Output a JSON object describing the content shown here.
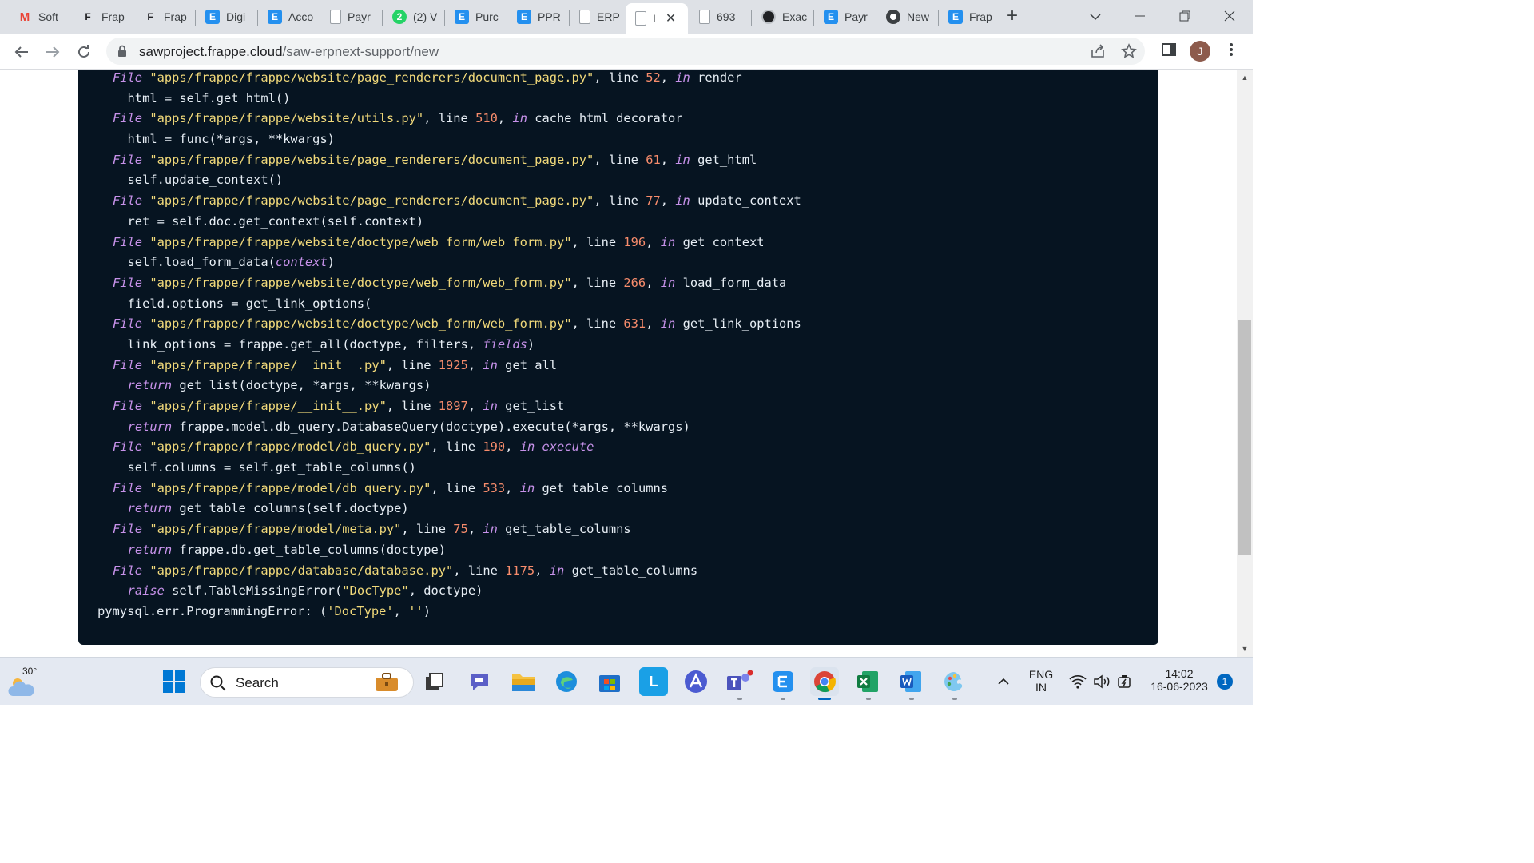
{
  "browser": {
    "tabs": [
      {
        "title": "Soft",
        "favicon": "gmail-icon",
        "color": "#ffffff"
      },
      {
        "title": "Frap",
        "favicon": "frappe-icon",
        "color": "#ffffff"
      },
      {
        "title": "Frap",
        "favicon": "frappe-icon",
        "color": "#ffffff"
      },
      {
        "title": "Digi",
        "favicon": "erpnext-icon",
        "color": "#2490ef"
      },
      {
        "title": "Acco",
        "favicon": "erpnext-icon",
        "color": "#2490ef"
      },
      {
        "title": "Payr",
        "favicon": "page-icon",
        "color": "#ffffff"
      },
      {
        "title": "(2) V",
        "favicon": "whatsapp-icon",
        "color": "#25d366"
      },
      {
        "title": "Purc",
        "favicon": "erpnext-icon",
        "color": "#2490ef"
      },
      {
        "title": "PPR",
        "favicon": "erpnext-icon",
        "color": "#2490ef"
      },
      {
        "title": "ERP",
        "favicon": "page-icon",
        "color": "#ffffff"
      },
      {
        "title": "I",
        "favicon": "page-icon",
        "color": "#ffffff"
      },
      {
        "title": "693",
        "favicon": "page-icon",
        "color": "#ffffff"
      },
      {
        "title": "Exac",
        "favicon": "chatgpt-icon",
        "color": "#10a37f"
      },
      {
        "title": "Payr",
        "favicon": "erpnext-icon",
        "color": "#2490ef"
      },
      {
        "title": "New",
        "favicon": "chrome-icon",
        "color": "#5f6368"
      },
      {
        "title": "Frap",
        "favicon": "erpnext-icon",
        "color": "#2490ef"
      }
    ],
    "address": {
      "domain": "sawproject.frappe.cloud",
      "path": "/saw-erpnext-support/new"
    },
    "avatar_letter": "J"
  },
  "traceback": [
    [
      [
        "f",
        "File "
      ],
      [
        "s",
        "\"apps/frappe/frappe/website/page_renderers/document_page.py\""
      ],
      [
        "p",
        ", line "
      ],
      [
        "n",
        "52"
      ],
      [
        "p",
        ", "
      ],
      [
        "i",
        "in"
      ],
      [
        "p",
        " render"
      ]
    ],
    [
      [
        "p",
        "  html = self.get_html()"
      ]
    ],
    [
      [
        "f",
        "File "
      ],
      [
        "s",
        "\"apps/frappe/frappe/website/utils.py\""
      ],
      [
        "p",
        ", line "
      ],
      [
        "n",
        "510"
      ],
      [
        "p",
        ", "
      ],
      [
        "i",
        "in"
      ],
      [
        "p",
        " cache_html_decorator"
      ]
    ],
    [
      [
        "p",
        "  html = func(*args, **kwargs)"
      ]
    ],
    [
      [
        "f",
        "File "
      ],
      [
        "s",
        "\"apps/frappe/frappe/website/page_renderers/document_page.py\""
      ],
      [
        "p",
        ", line "
      ],
      [
        "n",
        "61"
      ],
      [
        "p",
        ", "
      ],
      [
        "i",
        "in"
      ],
      [
        "p",
        " get_html"
      ]
    ],
    [
      [
        "p",
        "  self.update_context()"
      ]
    ],
    [
      [
        "f",
        "File "
      ],
      [
        "s",
        "\"apps/frappe/frappe/website/page_renderers/document_page.py\""
      ],
      [
        "p",
        ", line "
      ],
      [
        "n",
        "77"
      ],
      [
        "p",
        ", "
      ],
      [
        "i",
        "in"
      ],
      [
        "p",
        " update_context"
      ]
    ],
    [
      [
        "p",
        "  ret = self.doc.get_context(self.context)"
      ]
    ],
    [
      [
        "f",
        "File "
      ],
      [
        "s",
        "\"apps/frappe/frappe/website/doctype/web_form/web_form.py\""
      ],
      [
        "p",
        ", line "
      ],
      [
        "n",
        "196"
      ],
      [
        "p",
        ", "
      ],
      [
        "i",
        "in"
      ],
      [
        "p",
        " get_context"
      ]
    ],
    [
      [
        "p",
        "  self.load_form_data("
      ],
      [
        "i",
        "context"
      ],
      [
        "p",
        ")"
      ]
    ],
    [
      [
        "f",
        "File "
      ],
      [
        "s",
        "\"apps/frappe/frappe/website/doctype/web_form/web_form.py\""
      ],
      [
        "p",
        ", line "
      ],
      [
        "n",
        "266"
      ],
      [
        "p",
        ", "
      ],
      [
        "i",
        "in"
      ],
      [
        "p",
        " load_form_data"
      ]
    ],
    [
      [
        "p",
        "  field.options = get_link_options("
      ]
    ],
    [
      [
        "f",
        "File "
      ],
      [
        "s",
        "\"apps/frappe/frappe/website/doctype/web_form/web_form.py\""
      ],
      [
        "p",
        ", line "
      ],
      [
        "n",
        "631"
      ],
      [
        "p",
        ", "
      ],
      [
        "i",
        "in"
      ],
      [
        "p",
        " get_link_options"
      ]
    ],
    [
      [
        "p",
        "  link_options = frappe.get_all(doctype, filters, "
      ],
      [
        "i",
        "fields"
      ],
      [
        "p",
        ")"
      ]
    ],
    [
      [
        "f",
        "File "
      ],
      [
        "s",
        "\"apps/frappe/frappe/__init__.py\""
      ],
      [
        "p",
        ", line "
      ],
      [
        "n",
        "1925"
      ],
      [
        "p",
        ", "
      ],
      [
        "i",
        "in"
      ],
      [
        "p",
        " get_all"
      ]
    ],
    [
      [
        "p",
        "  "
      ],
      [
        "i",
        "return"
      ],
      [
        "p",
        " get_list(doctype, *args, **kwargs)"
      ]
    ],
    [
      [
        "f",
        "File "
      ],
      [
        "s",
        "\"apps/frappe/frappe/__init__.py\""
      ],
      [
        "p",
        ", line "
      ],
      [
        "n",
        "1897"
      ],
      [
        "p",
        ", "
      ],
      [
        "i",
        "in"
      ],
      [
        "p",
        " get_list"
      ]
    ],
    [
      [
        "p",
        "  "
      ],
      [
        "i",
        "return"
      ],
      [
        "p",
        " frappe.model.db_query.DatabaseQuery(doctype).execute(*args, **kwargs)"
      ]
    ],
    [
      [
        "f",
        "File "
      ],
      [
        "s",
        "\"apps/frappe/frappe/model/db_query.py\""
      ],
      [
        "p",
        ", line "
      ],
      [
        "n",
        "190"
      ],
      [
        "p",
        ", "
      ],
      [
        "i",
        "in"
      ],
      [
        "p",
        " "
      ],
      [
        "i",
        "execute"
      ]
    ],
    [
      [
        "p",
        "  self.columns = self.get_table_columns()"
      ]
    ],
    [
      [
        "f",
        "File "
      ],
      [
        "s",
        "\"apps/frappe/frappe/model/db_query.py\""
      ],
      [
        "p",
        ", line "
      ],
      [
        "n",
        "533"
      ],
      [
        "p",
        ", "
      ],
      [
        "i",
        "in"
      ],
      [
        "p",
        " get_table_columns"
      ]
    ],
    [
      [
        "p",
        "  "
      ],
      [
        "i",
        "return"
      ],
      [
        "p",
        " get_table_columns(self.doctype)"
      ]
    ],
    [
      [
        "f",
        "File "
      ],
      [
        "s",
        "\"apps/frappe/frappe/model/meta.py\""
      ],
      [
        "p",
        ", line "
      ],
      [
        "n",
        "75"
      ],
      [
        "p",
        ", "
      ],
      [
        "i",
        "in"
      ],
      [
        "p",
        " get_table_columns"
      ]
    ],
    [
      [
        "p",
        "  "
      ],
      [
        "i",
        "return"
      ],
      [
        "p",
        " frappe.db.get_table_columns(doctype)"
      ]
    ],
    [
      [
        "f",
        "File "
      ],
      [
        "s",
        "\"apps/frappe/frappe/database/database.py\""
      ],
      [
        "p",
        ", line "
      ],
      [
        "n",
        "1175"
      ],
      [
        "p",
        ", "
      ],
      [
        "i",
        "in"
      ],
      [
        "p",
        " get_table_columns"
      ]
    ],
    [
      [
        "p",
        "  "
      ],
      [
        "i",
        "raise"
      ],
      [
        "p",
        " self.TableMissingError("
      ],
      [
        "s",
        "\"DocType\""
      ],
      [
        "p",
        ", doctype)"
      ]
    ],
    [
      [
        "x",
        "pymysql.err.ProgrammingError: ("
      ],
      [
        "s",
        "'DocType'"
      ],
      [
        "x",
        ", "
      ],
      [
        "s",
        "''"
      ],
      [
        "x",
        ")"
      ]
    ]
  ],
  "taskbar": {
    "temperature": "30°",
    "search_label": "Search",
    "language_top": "ENG",
    "language_bottom": "IN",
    "time": "14:02",
    "date": "16-06-2023",
    "notification_count": "1"
  }
}
